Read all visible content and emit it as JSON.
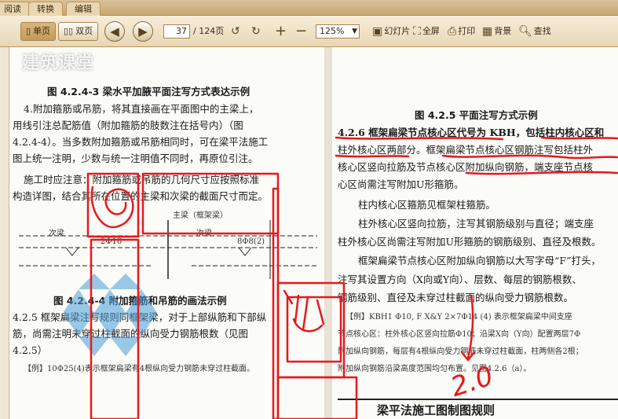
{
  "tabs": [
    {
      "label": "阅读"
    },
    {
      "label": "转换"
    },
    {
      "label": "编辑"
    }
  ],
  "toolbar": {
    "single_page": "单页",
    "double_page": "双页",
    "page_current": "37",
    "page_total": "/ 124页",
    "zoom": "125%",
    "slideshow": "幻灯片",
    "fullscreen": "全屏",
    "print": "打印",
    "background": "背景",
    "search": "查找"
  },
  "watermark": "建筑课堂",
  "left_page": {
    "caption_top": "图 4.2.4-3  梁水平加腋平面注写方式表达示例",
    "para1": [
      "4.附加箍筋或吊筋，将其直接画在平面图中的主梁上，",
      "用线引注总配筋值（附加箍筋的肢数注在括号内）（图",
      "4.2.4-4）。当多数附加箍筋或吊筋相同时，可在梁平法施工",
      "图上统一注明，少数与统一注明值不同时，再原位引注。"
    ],
    "para2": [
      "施工时应注意：附加箍筋或吊筋的几何尺寸应按照标准",
      "构造详图，结合其所在位置的主梁和次梁的截面尺寸而定。"
    ],
    "fig_main_beam": "主梁（框架梁）",
    "fig_secondary_left": "次梁",
    "fig_secondary_right": "次梁",
    "fig_label_left": "2Φ18",
    "fig_label_right": "8Φ8(2)",
    "caption_fig": "图 4.2.4-4  附加箍筋和吊筋的画法示例",
    "para3": [
      "4.2.5  框架扁梁注写规则同框架梁，对于上部纵筋和下部纵",
      "筋，尚需注明未穿过柱截面的纵向受力钢筋根数（见图",
      "4.2.5）"
    ],
    "example": "【例】10Φ25(4)表示框架扁梁有4根纵向受力钢筋未穿过柱截面。"
  },
  "right_page": {
    "caption_top": "图 4.2.5  平面注写方式示例",
    "heading": "4.2.6  框架扁梁节点核心区代号为 KBH，包括柱内核心区和",
    "lines": [
      "柱外核心区两部分。框架扁梁节点核心区钢筋注写包括柱外",
      "核心区竖向拉筋及节点核心区附加纵向钢筋，端支座节点核",
      "心区尚需注写附加U形箍筋。",
      "柱内核心区箍筋见框架柱箍筋。",
      "柱外核心区竖向拉筋，注写其钢筋级别与直径；端支座",
      "柱外核心区尚需注写附加U形箍筋的钢筋级别、直径及根数。",
      "框架扁梁节点核心区附加纵向钢筋以大写字母“F”打头，",
      "注写其设置方向（X向或Y向）、层数、每层的钢筋根数、",
      "钢筋级别、直径及未穿过柱截面的纵向受力钢筋根数。"
    ],
    "example1": "【例】KBH1 Φ10, F X&Y 2×7Φ14 (4)  表示框架扁梁中间支座",
    "example2": "节点核心区：柱外核心区竖向拉筋Φ10；沿梁X向（Y向）配置两层7Φ",
    "example3": "附加纵向钢筋，每层有4根纵向受力钢筋未穿过柱截面，柱两侧各2根；",
    "example4": "附加纵向钢筋沿梁高度范围均匀布置。见图4.2.6（a）。",
    "footer": "梁平法施工图制图规则"
  },
  "annotation_text": "2.0",
  "colors": {
    "pen": "#e8181c",
    "accent": "#c49a58"
  }
}
